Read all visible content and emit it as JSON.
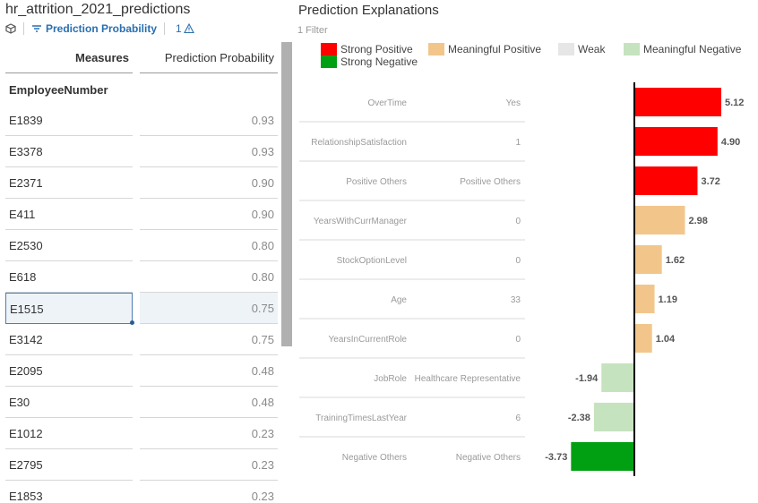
{
  "app": {
    "title": "hr_attrition_2021_predictions",
    "filter_label": "Prediction Probability",
    "warning_count": "1"
  },
  "table": {
    "header_measures": "Measures",
    "header_prob": "Prediction Probability",
    "row_header": "EmployeeNumber",
    "rows": [
      {
        "id": "E1839",
        "value": "0.93"
      },
      {
        "id": "E3378",
        "value": "0.93"
      },
      {
        "id": "E2371",
        "value": "0.90"
      },
      {
        "id": "E411",
        "value": "0.90"
      },
      {
        "id": "E2530",
        "value": "0.80"
      },
      {
        "id": "E618",
        "value": "0.80"
      },
      {
        "id": "E1515",
        "value": "0.75"
      },
      {
        "id": "E3142",
        "value": "0.75"
      },
      {
        "id": "E2095",
        "value": "0.48"
      },
      {
        "id": "E30",
        "value": "0.48"
      },
      {
        "id": "E1012",
        "value": "0.23"
      },
      {
        "id": "E2795",
        "value": "0.23"
      },
      {
        "id": "E1853",
        "value": "0.23"
      }
    ],
    "selected_index": 6
  },
  "explanations": {
    "title": "Prediction Explanations",
    "filter_count": "1 Filter"
  },
  "chart_data": {
    "type": "bar",
    "orientation": "horizontal",
    "title": "Prediction Explanations",
    "legend": [
      {
        "name": "Strong Positive",
        "color": "#ff0000"
      },
      {
        "name": "Meaningful Positive",
        "color": "#f2c68b"
      },
      {
        "name": "Weak",
        "color": "#e6e6e6"
      },
      {
        "name": "Meaningful Negative",
        "color": "#c6e3bf"
      },
      {
        "name": "Strong Negative",
        "color": "#00a012"
      }
    ],
    "categories": [
      {
        "variable": "OverTime",
        "value": "Yes"
      },
      {
        "variable": "RelationshipSatisfaction",
        "value": "1"
      },
      {
        "variable": "Positive Others",
        "value": "Positive Others"
      },
      {
        "variable": "YearsWithCurrManager",
        "value": "0"
      },
      {
        "variable": "StockOptionLevel",
        "value": "0"
      },
      {
        "variable": "Age",
        "value": "33"
      },
      {
        "variable": "YearsInCurrentRole",
        "value": "0"
      },
      {
        "variable": "JobRole",
        "value": "Healthcare Representative"
      },
      {
        "variable": "TrainingTimesLastYear",
        "value": "6"
      },
      {
        "variable": "Negative Others",
        "value": "Negative Others"
      }
    ],
    "values": [
      5.12,
      4.9,
      3.72,
      2.98,
      1.62,
      1.19,
      1.04,
      -1.94,
      -2.38,
      -3.73
    ],
    "value_labels": [
      "5.12",
      "4.90",
      "3.72",
      "2.98",
      "1.62",
      "1.19",
      "1.04",
      "-1.94",
      "-2.38",
      "-3.73"
    ],
    "strength": [
      "Strong Positive",
      "Strong Positive",
      "Strong Positive",
      "Meaningful Positive",
      "Meaningful Positive",
      "Meaningful Positive",
      "Meaningful Positive",
      "Meaningful Negative",
      "Meaningful Negative",
      "Strong Negative"
    ],
    "xlim": [
      -3.73,
      5.12
    ],
    "legend_position": "top"
  }
}
